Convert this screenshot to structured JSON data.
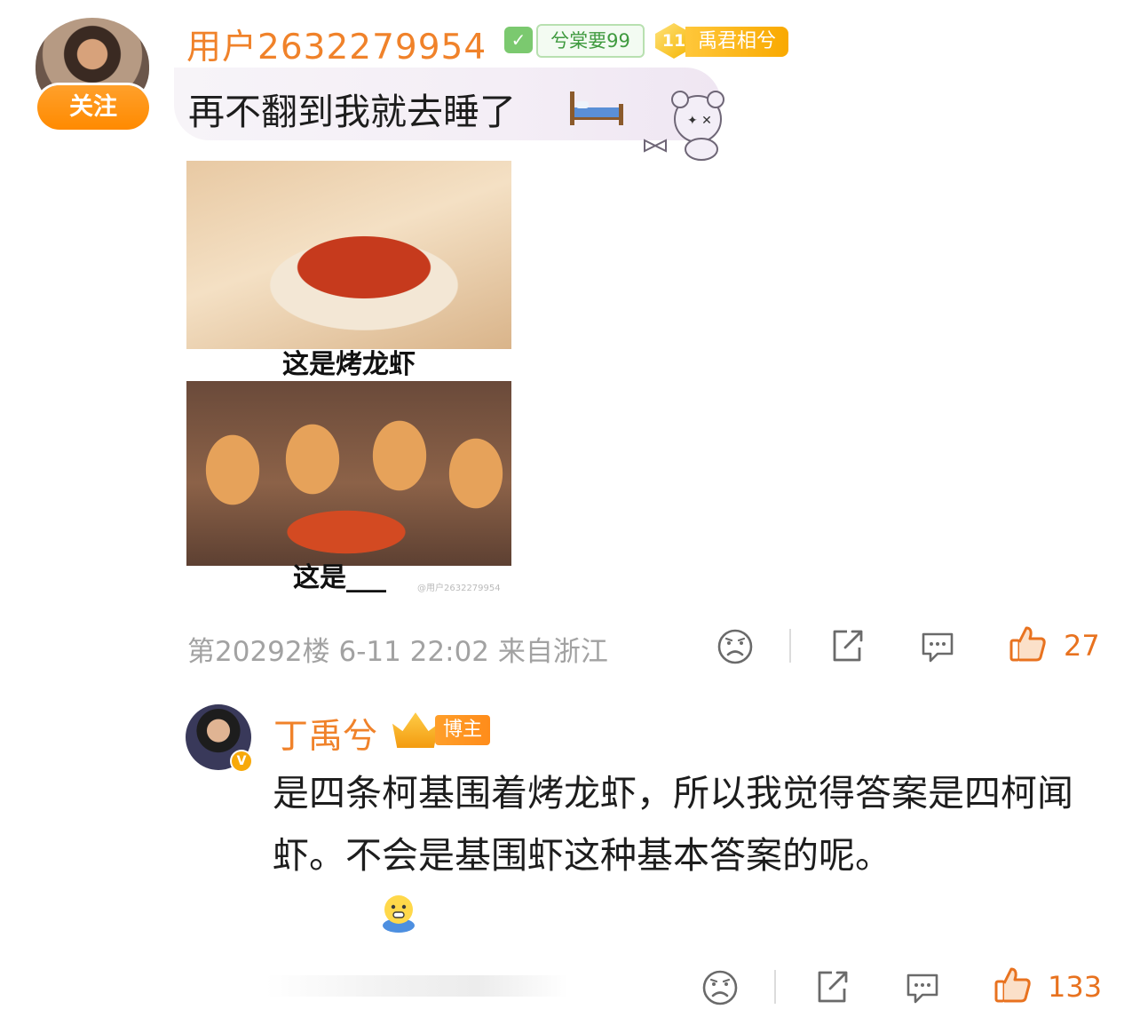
{
  "comment": {
    "follow_label": "关注",
    "username": "用户2632279954",
    "fan_badge": "兮棠要99",
    "level_badge_num": "11",
    "level_badge": "禹君相兮",
    "text": "再不翻到我就去睡了",
    "meme": {
      "caption_top": "这是烤龙虾",
      "caption_bottom": "这是___",
      "watermark": "@用户2632279954"
    },
    "meta": "第20292楼 6-11 22:02 来自浙江",
    "like_count": "27"
  },
  "reply": {
    "username": "丁禹兮",
    "host_badge": "博主",
    "verified_mark": "V",
    "text": "是四条柯基围着烤龙虾，所以我觉得答案是四柯闻虾。不会是基围虾这种基本答案的呢。",
    "like_count": "133"
  },
  "colors": {
    "accent": "#f0822a",
    "follow_button": "#ff8a00",
    "like": "#e8721f"
  },
  "icons": [
    "sad-face-icon",
    "share-icon",
    "comment-icon",
    "thumbs-up-icon",
    "bed-icon",
    "emoji-icon"
  ]
}
